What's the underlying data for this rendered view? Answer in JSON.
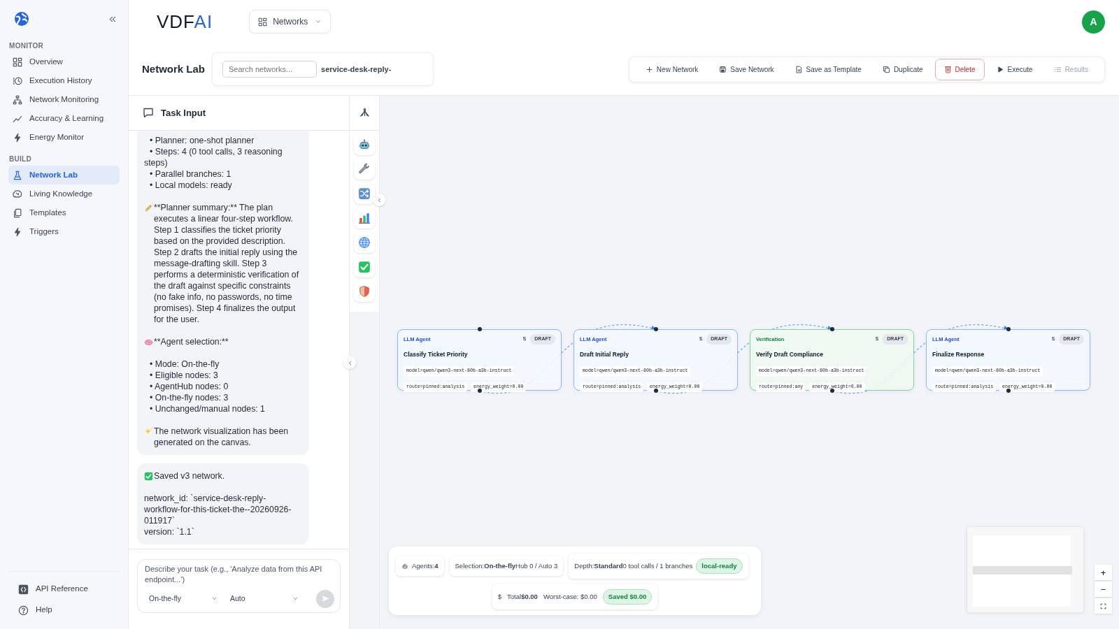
{
  "sidebar": {
    "sections": [
      {
        "title": "MONITOR",
        "items": [
          {
            "label": "Overview",
            "selected": false
          },
          {
            "label": "Execution History",
            "selected": false
          },
          {
            "label": "Network Monitoring",
            "selected": false
          },
          {
            "label": "Accuracy & Learning",
            "selected": false
          },
          {
            "label": "Energy Monitor",
            "selected": false
          }
        ]
      },
      {
        "title": "BUILD",
        "items": [
          {
            "label": "Network Lab",
            "selected": true
          },
          {
            "label": "Living Knowledge",
            "selected": false
          },
          {
            "label": "Templates",
            "selected": false
          },
          {
            "label": "Triggers",
            "selected": false
          }
        ]
      }
    ],
    "footer_items": [
      {
        "label": "API Reference"
      },
      {
        "label": "Help"
      }
    ]
  },
  "header": {
    "logo": {
      "text": "VDF",
      "accent": "AI"
    },
    "menu": {
      "label": "Networks"
    },
    "avatar": "A"
  },
  "page": {
    "title": "Network Lab",
    "search": {
      "placeholder": "Search networks...",
      "current": "service-desk-reply-"
    }
  },
  "toolbar": [
    {
      "label": "New Network",
      "kind": "plain",
      "disabled": false
    },
    {
      "label": "Save Network",
      "kind": "plain",
      "disabled": false
    },
    {
      "label": "Save as Template",
      "kind": "plain",
      "disabled": false
    },
    {
      "label": "Duplicate",
      "kind": "plain",
      "disabled": false
    },
    {
      "label": "Delete",
      "kind": "danger",
      "disabled": false
    },
    {
      "label": "Execute",
      "kind": "plain",
      "disabled": false
    },
    {
      "label": "Results",
      "kind": "plain",
      "disabled": true
    }
  ],
  "task_panel": {
    "title": "Task Input",
    "messages": [
      {
        "blocks": [
          {
            "kind": "bullets",
            "items": [
              "• Planner: one-shot planner",
              "• Steps: 4 (0 tool calls, 3 reasoning steps)",
              "• Parallel branches: 1",
              "• Local models: ready"
            ]
          },
          {
            "kind": "emoji_paragraph",
            "text": "**Planner summary:** The plan executes a linear four-step workflow. Step 1 classifies the ticket priority based on the provided description. Step 2 drafts the initial reply using the message-drafting skill. Step 3 performs a deterministic verification of the draft against specific constraints (no fake info, no passwords, no time promises). Step 4 finalizes the output for the user."
          },
          {
            "kind": "emoji_paragraph",
            "text": "**Agent selection:**"
          },
          {
            "kind": "bullets",
            "items": [
              "• Mode: On-the-fly",
              "• Eligible nodes: 3",
              "• AgentHub nodes: 0",
              "• On-the-fly nodes: 3",
              "• Unchanged/manual nodes: 1"
            ]
          },
          {
            "kind": "emoji_paragraph",
            "text": "The network visualization has been generated on the canvas."
          }
        ]
      },
      {
        "blocks": [
          {
            "kind": "emoji_paragraph",
            "text": "Saved v3 network."
          },
          {
            "kind": "lines",
            "items": [
              "network_id: `service-desk-reply-workflow-for-this-ticket-the--20260926-011917`",
              "version: `1.1`"
            ]
          }
        ]
      }
    ],
    "input": {
      "placeholder": "Describe your task (e.g., 'Analyze data from this API endpoint...')",
      "mode": "On-the-fly",
      "model": "Auto",
      "send_disabled": true
    }
  },
  "canvas": {
    "nodes": [
      {
        "type": "LLM Agent",
        "kind": "agent",
        "cost": "$",
        "status": "DRAFT",
        "title": "Classify Ticket Priority",
        "model": "model=qwen/qwen3-next-80b-a3b-instruct",
        "route": "route=pinned:analysis",
        "energy": "energy_weight=0.00"
      },
      {
        "type": "LLM Agent",
        "kind": "agent",
        "cost": "$",
        "status": "DRAFT",
        "title": "Draft Initial Reply",
        "model": "model=qwen/qwen3-next-80b-a3b-instruct",
        "route": "route=pinned:analysis",
        "energy": "energy_weight=0.00"
      },
      {
        "type": "Verification",
        "kind": "verification",
        "cost": "$",
        "status": "DRAFT",
        "title": "Verify Draft Compliance",
        "model": "model=qwen/qwen3-next-80b-a3b-instruct",
        "route": "route=pinned:any",
        "energy": "energy_weight=0.00"
      },
      {
        "type": "LLM Agent",
        "kind": "agent",
        "cost": "$",
        "status": "DRAFT",
        "title": "Finalize Response",
        "model": "model=qwen/qwen3-next-80b-a3b-instruct",
        "route": "route=pinned:analysis",
        "energy": "energy_weight=0.00"
      }
    ],
    "summary": {
      "stats": [
        {
          "text": "Agents:**4**"
        },
        {
          "text": "Selection:**On-the-fly**Hub 0 / Auto 3"
        },
        {
          "text": "Depth:**Standard**0 tool calls / 1 branches",
          "badge": "local-ready"
        }
      ],
      "cost": {
        "symbol": "$",
        "total": "Total**$0.00**",
        "worst_case": "Worst-case: $0.00",
        "badge": "Saved $0.00"
      }
    },
    "zoom": {
      "in": "+",
      "out": "−"
    }
  }
}
